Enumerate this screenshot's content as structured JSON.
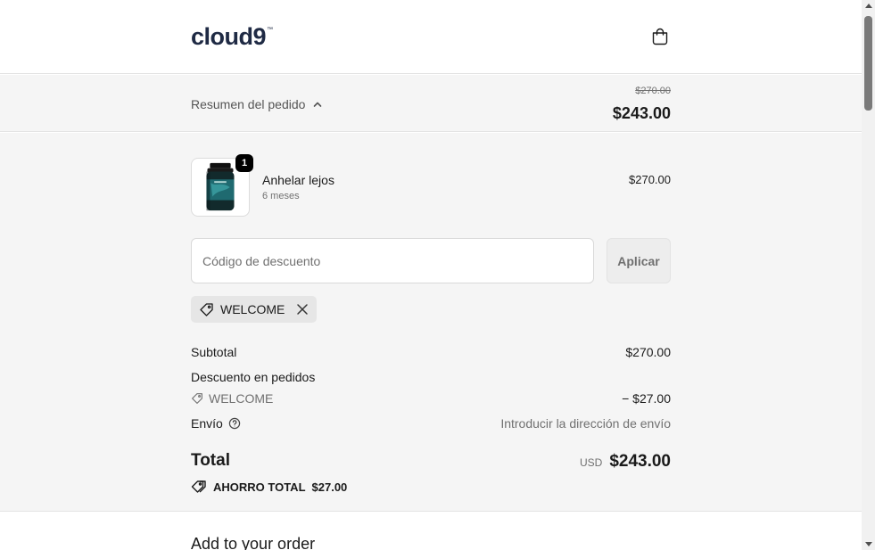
{
  "header": {
    "logo": "cloud9",
    "logo_tm": "™",
    "cart_icon": "shopping-bag-icon"
  },
  "summary": {
    "toggle_label": "Resumen del pedido",
    "toggle_icon": "chevron-up-icon",
    "original_price": "$270.00",
    "total_price": "$243.00"
  },
  "product": {
    "quantity": "1",
    "name": "Anhelar lejos",
    "variant": "6 meses",
    "price": "$270.00"
  },
  "discount": {
    "placeholder": "Código de descuento",
    "apply_label": "Aplicar",
    "applied_code": "WELCOME"
  },
  "totals": {
    "subtotal_label": "Subtotal",
    "subtotal_value": "$270.00",
    "order_discount_label": "Descuento en pedidos",
    "discount_code": "WELCOME",
    "discount_value": "− $27.00",
    "shipping_label": "Envío",
    "shipping_value": "Introducir la dirección de envío",
    "total_label": "Total",
    "total_currency": "USD",
    "total_value": "$243.00",
    "savings_label": "AHORRO TOTAL",
    "savings_value": "$27.00"
  },
  "addons": {
    "title": "Add to your order"
  },
  "colors": {
    "brand": "#1f2a44",
    "panel_bg": "#f5f5f5",
    "badge_bg": "#000000"
  }
}
